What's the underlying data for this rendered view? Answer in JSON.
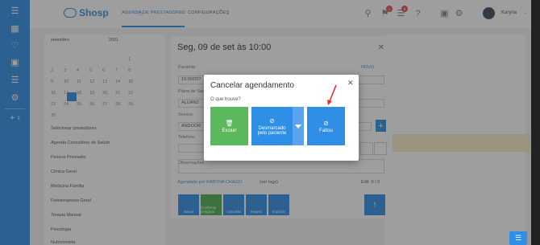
{
  "app": {
    "name": "Shosp"
  },
  "header": {
    "tabs": [
      {
        "label": "AGENDA DE PRESTADORES",
        "active": true
      },
      {
        "label": "CONFIGURAÇÕES",
        "active": false
      }
    ],
    "notification_badge": "1",
    "message_badge": "8",
    "username": "Karyna"
  },
  "sidebar": {
    "items": [
      "menu",
      "dashboard",
      "favorites",
      "finance",
      "database",
      "settings",
      "add"
    ]
  },
  "background_panel": {
    "month": "setembro",
    "year": "2021",
    "calendar_days": [
      "1",
      "2",
      "3",
      "4",
      "5",
      "6",
      "7",
      "8",
      "9",
      "10",
      "11",
      "12",
      "13",
      "14",
      "15",
      "16",
      "17",
      "18",
      "19",
      "20",
      "21",
      "22",
      "23",
      "24",
      "25",
      "26",
      "27",
      "28",
      "29",
      "30"
    ],
    "list": [
      "Selecionar prestadores",
      "Agenda Consultório de Saúde",
      "Pessoa Prestador",
      "Clínica Geral",
      "Medicina Familia",
      "Fisioterapeuta Geral",
      "Terapia Manual",
      "Psicologia",
      "Nutricionista"
    ]
  },
  "appointment_modal": {
    "title": "Seg, 09 de set às 10:00",
    "novo_label": "NOVO",
    "labels": {
      "paciente": "Paciente",
      "plano": "Plano de Saúde",
      "servico": "Serviço",
      "telefone": "Telefone",
      "observacoes": "Observações"
    },
    "values": {
      "paciente": "10:00/05?",
      "plano": "ALUANZ",
      "servico": "ANDOOR"
    },
    "agendado": "Agendado por KARYNA CHAGO",
    "ver_logs": "(ver logs)",
    "edit": "Edit: 0 / 0",
    "actions": [
      "Salvar",
      "Confirmar chegada",
      "Cancelar",
      "Repetir",
      "Imprimir"
    ]
  },
  "cancel_dialog": {
    "title": "Cancelar agendamento",
    "question": "O que houve?",
    "options": [
      {
        "label": "Excluir",
        "icon": "trash-icon",
        "color": "#5cb85c"
      },
      {
        "label": "Desmarcado pelo paciente",
        "icon": "cancel-circle-icon",
        "color": "#2f8ee6"
      },
      {
        "label": "Faltou",
        "icon": "cancel-circle-icon",
        "color": "#2f8ee6"
      }
    ]
  },
  "colors": {
    "primary": "#2f8ee6",
    "success": "#5cb85c",
    "annotation": "#e0312b"
  }
}
